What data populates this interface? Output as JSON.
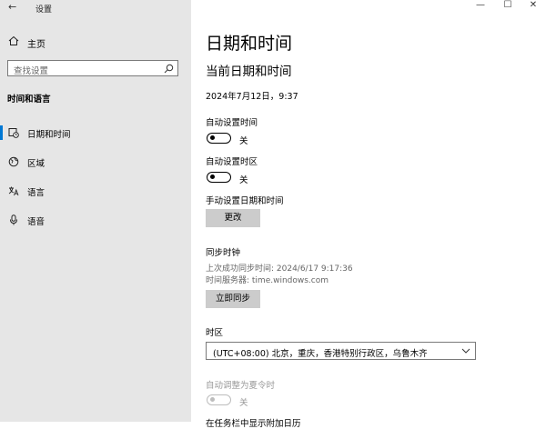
{
  "window": {
    "app_title": "设置",
    "back_glyph": "←",
    "minimize_glyph": "—",
    "maximize_glyph": "☐",
    "close_glyph": "✕"
  },
  "sidebar": {
    "home_label": "主页",
    "search_placeholder": "查找设置",
    "section_title": "时间和语言",
    "items": [
      {
        "label": "日期和时间",
        "icon": "clock-icon",
        "active": true
      },
      {
        "label": "区域",
        "icon": "globe-icon",
        "active": false
      },
      {
        "label": "语言",
        "icon": "language-icon",
        "active": false
      },
      {
        "label": "语音",
        "icon": "microphone-icon",
        "active": false
      }
    ]
  },
  "main": {
    "title": "日期和时间",
    "subtitle": "当前日期和时间",
    "current_datetime": "2024年7月12日，9:37",
    "auto_time": {
      "label": "自动设置时间",
      "state": "关"
    },
    "auto_timezone": {
      "label": "自动设置时区",
      "state": "关"
    },
    "manual": {
      "label": "手动设置日期和时间",
      "button": "更改"
    },
    "sync": {
      "heading": "同步时钟",
      "last_sync": "上次成功同步时间: 2024/6/17 9:17:36",
      "server": "时间服务器: time.windows.com",
      "button": "立即同步"
    },
    "timezone": {
      "label": "时区",
      "value": "(UTC+08:00) 北京，重庆，香港特别行政区，乌鲁木齐"
    },
    "dst": {
      "label": "自动调整为夏令时",
      "state": "关"
    },
    "cut_off_text": "在任务栏中显示附加日历"
  },
  "colors": {
    "accent": "#0078d4",
    "sidebar_bg": "#e6e6e6",
    "button_bg": "#cccccc"
  }
}
